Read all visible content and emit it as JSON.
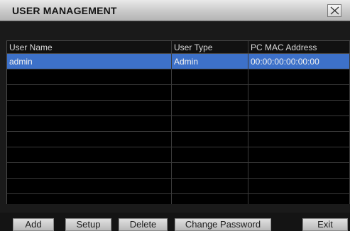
{
  "window": {
    "title": "USER MANAGEMENT"
  },
  "table": {
    "columns": [
      "User Name",
      "User Type",
      "PC MAC Address"
    ],
    "rows": [
      [
        "admin",
        "Admin",
        "00:00:00:00:00:00"
      ]
    ],
    "selected_row": 0
  },
  "buttons": {
    "add": "Add",
    "setup": "Setup",
    "delete": "Delete",
    "change_password": "Change Password",
    "exit": "Exit"
  },
  "icons": {
    "close": "close-icon"
  },
  "colors": {
    "selection": "#3d71c9",
    "background": "#1a1a1a",
    "titlebar": "#d3d3d3"
  }
}
